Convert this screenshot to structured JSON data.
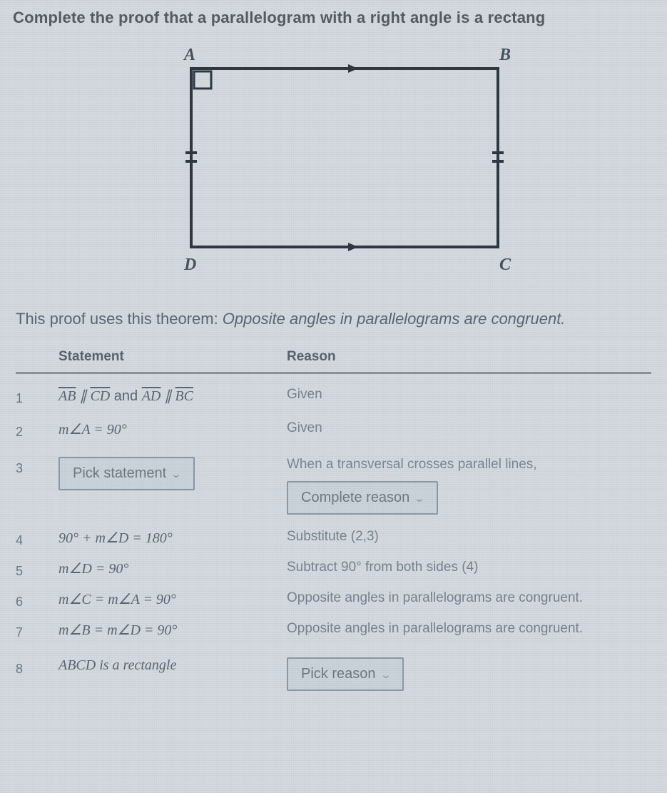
{
  "title": "Complete the proof that a parallelogram with a right angle is a rectang",
  "figure": {
    "A": "A",
    "B": "B",
    "C": "C",
    "D": "D"
  },
  "theorem": {
    "lead": "This proof uses this theorem: ",
    "body": "Opposite angles in parallelograms are congruent."
  },
  "headers": {
    "statement": "Statement",
    "reason": "Reason"
  },
  "rows": {
    "r1": {
      "n": "1",
      "s_ab": "AB",
      "s_par1": " ∥ ",
      "s_cd": "CD",
      "s_and": " and ",
      "s_ad": "AD",
      "s_par2": " ∥ ",
      "s_bc": "BC",
      "reason": "Given"
    },
    "r2": {
      "n": "2",
      "stmt": "m∠A = 90°",
      "reason": "Given"
    },
    "r3": {
      "n": "3",
      "pick_stmt": "Pick statement",
      "reason_line": "When a transversal crosses parallel lines,",
      "complete_reason": "Complete reason"
    },
    "r4": {
      "n": "4",
      "stmt": "90° + m∠D = 180°",
      "reason": "Substitute (2,3)"
    },
    "r5": {
      "n": "5",
      "stmt": "m∠D = 90°",
      "reason": "Subtract 90° from both sides (4)"
    },
    "r6": {
      "n": "6",
      "stmt": "m∠C = m∠A = 90°",
      "reason": "Opposite angles in parallelograms are congruent."
    },
    "r7": {
      "n": "7",
      "stmt": "m∠B = m∠D = 90°",
      "reason": "Opposite angles in parallelograms are congruent."
    },
    "r8": {
      "n": "8",
      "stmt": "ABCD is a rectangle",
      "pick_reason": "Pick reason"
    }
  }
}
